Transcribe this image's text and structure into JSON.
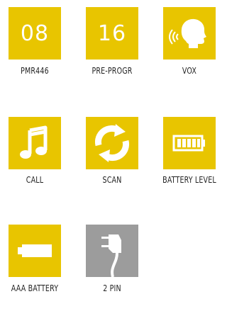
{
  "tiles": [
    {
      "label": "PMR446",
      "value": "08",
      "icon": "number-08"
    },
    {
      "label": "PRE-PROGR",
      "value": "16",
      "icon": "number-16"
    },
    {
      "label": "VOX",
      "icon": "head-voice-icon"
    },
    {
      "label": "CALL",
      "icon": "music-note-icon"
    },
    {
      "label": "SCAN",
      "icon": "refresh-arrows-icon"
    },
    {
      "label": "BATTERY LEVEL",
      "icon": "battery-level-icon"
    },
    {
      "label": "AAA BATTERY",
      "icon": "aaa-battery-icon"
    },
    {
      "label": "2 PIN",
      "icon": "two-pin-connector-icon"
    }
  ],
  "colors": {
    "accent": "#e8c500",
    "gray_tile": "#9c9c9c",
    "icon": "#ffffff",
    "text": "#222222"
  }
}
